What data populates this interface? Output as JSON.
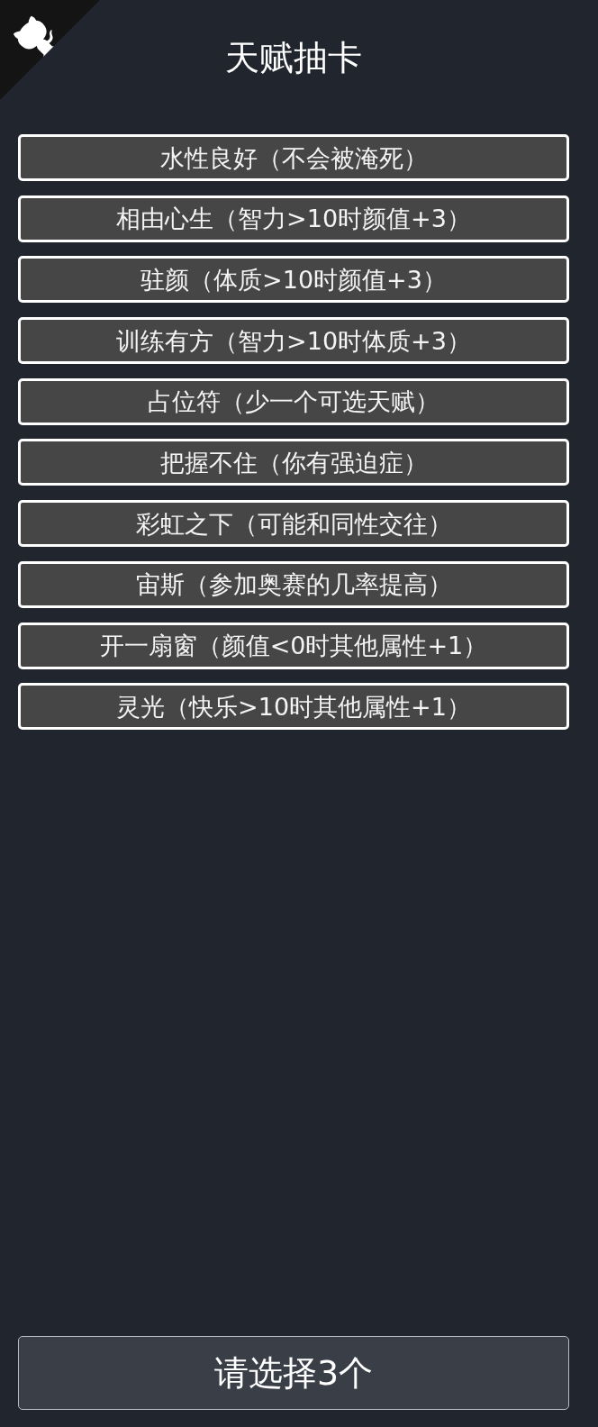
{
  "header": {
    "title": "天赋抽卡"
  },
  "talents": [
    {
      "label": "水性良好（不会被淹死）",
      "selected": false
    },
    {
      "label": "相由心生（智力>10时颜值+3）",
      "selected": false
    },
    {
      "label": "驻颜（体质>10时颜值+3）",
      "selected": false
    },
    {
      "label": "训练有方（智力>10时体质+3）",
      "selected": false
    },
    {
      "label": "占位符（少一个可选天赋）",
      "selected": false
    },
    {
      "label": "把握不住（你有强迫症）",
      "selected": false
    },
    {
      "label": "彩虹之下（可能和同性交往）",
      "selected": false
    },
    {
      "label": "宙斯（参加奥赛的几率提高）",
      "selected": false
    },
    {
      "label": "开一扇窗（颜值<0时其他属性+1）",
      "selected": false
    },
    {
      "label": "灵光（快乐>10时其他属性+1）",
      "selected": false
    }
  ],
  "confirm_button": {
    "label": "请选择3个"
  }
}
